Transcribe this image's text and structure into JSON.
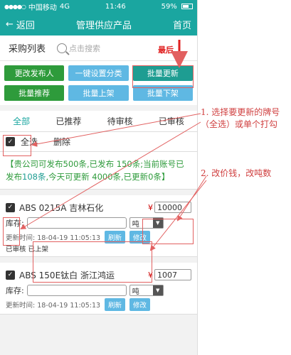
{
  "status_bar": {
    "carrier": "中国移动",
    "network": "4G",
    "time": "11:46",
    "battery": "59%"
  },
  "nav": {
    "back_label": "返回",
    "title": "管理供应产品",
    "home_label": "首页"
  },
  "search": {
    "list_label": "采购列表",
    "placeholder": "点击搜索"
  },
  "actions": {
    "change_publisher": "更改发布人",
    "set_category": "一键设置分类",
    "batch_update": "批量更新",
    "batch_recommend": "批量推荐",
    "batch_list": "批量上架",
    "batch_delist": "批量下架"
  },
  "tabs": [
    "全部",
    "已推荐",
    "待审核",
    "已审核"
  ],
  "select": {
    "select_all": "全选",
    "delete": "删除"
  },
  "info": {
    "part1": "【贵公司可发布500条,已发布 150条;当前账号已发布",
    "count": "108条",
    "part2": ",今天可更新 4000条,已更新0条】"
  },
  "products": [
    {
      "title": "ABS 0215A 吉林石化",
      "currency": "¥",
      "price": "10000",
      "stock_label": "库存:",
      "unit": "吨",
      "updated": "更新时间: 18-04-19 11:05:13",
      "refresh": "刷新",
      "edit": "修改",
      "status": "已审核 已上架"
    },
    {
      "title": "ABS 150E钛白 浙江鸿运",
      "currency": "¥",
      "price": "1007",
      "stock_label": "库存:",
      "unit": "吨",
      "updated": "更新时间: 18-04-19 11:05:13",
      "refresh": "刷新",
      "edit": "修改"
    }
  ],
  "annotations": {
    "last": "最后",
    "step1_line1": "1. 选择要更新的牌号",
    "step1_line2": "（全选）或单个打勾",
    "step2": "2. 改价钱，改吨数"
  },
  "colors": {
    "teal": "#1aa6a0",
    "green": "#2e9b3b",
    "blue": "#5fb8e3",
    "annotation_red": "#d04040"
  }
}
